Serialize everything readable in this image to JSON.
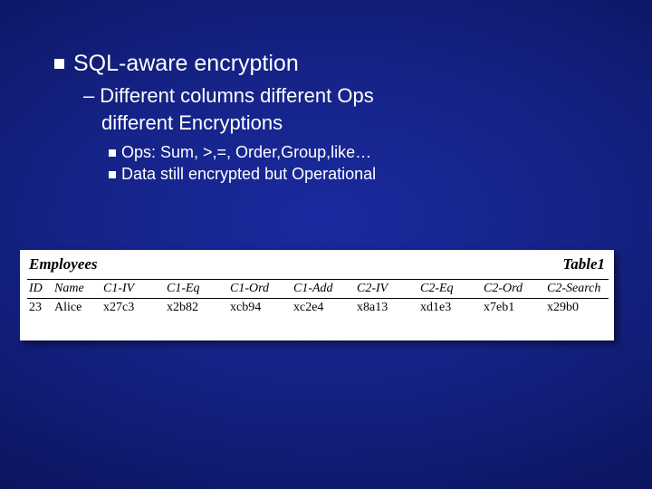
{
  "bullets": {
    "main": "SQL-aware encryption",
    "sub1_line1": "Different columns different Ops",
    "sub1_line2": "different Encryptions",
    "sub2a": "Ops: Sum, >,=, Order,Group,like…",
    "sub2b": "Data still encrypted but Operational",
    "dash": "–"
  },
  "table": {
    "left_title": "Employees",
    "right_title": "Table1",
    "headers": {
      "id": "ID",
      "name": "Name",
      "c1iv": "C1-IV",
      "c1eq": "C1-Eq",
      "c1ord": "C1-Ord",
      "c1add": "C1-Add",
      "c2iv": "C2-IV",
      "c2eq": "C2-Eq",
      "c2ord": "C2-Ord",
      "c2search": "C2-Search"
    },
    "row": {
      "id": "23",
      "name": "Alice",
      "c1iv": "x27c3",
      "c1eq": "x2b82",
      "c1ord": "xcb94",
      "c1add": "xc2e4",
      "c2iv": "x8a13",
      "c2eq": "xd1e3",
      "c2ord": "x7eb1",
      "c2search": "x29b0"
    }
  }
}
